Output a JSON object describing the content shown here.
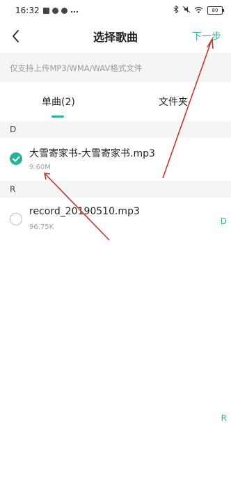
{
  "status": {
    "time": "16:32",
    "battery": "80"
  },
  "nav": {
    "back_icon": "chevron-left-icon",
    "title": "选择歌曲",
    "next_label": "下一步"
  },
  "notice": "仅支持上传MP3/WMA/WAV格式文件",
  "tabs": [
    {
      "label": "单曲(2)",
      "active": true
    },
    {
      "label": "文件夹",
      "active": false
    }
  ],
  "sections": [
    {
      "header": "D",
      "items": [
        {
          "name": "大雪寄家书-大雪寄家书.mp3",
          "size": "9.60M",
          "checked": true
        }
      ]
    },
    {
      "header": "R",
      "items": [
        {
          "name": "record_20190510.mp3",
          "size": "96.75K",
          "checked": false
        }
      ]
    }
  ],
  "index_bar": [
    "D",
    "R"
  ],
  "colors": {
    "accent": "#2bb39a",
    "annotation": "#c0392b"
  }
}
